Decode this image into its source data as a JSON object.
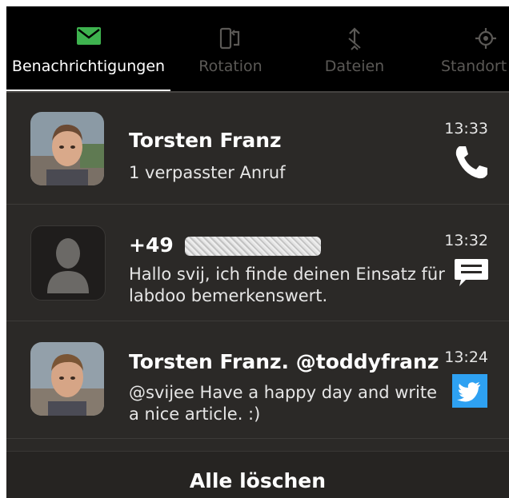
{
  "tabs": [
    {
      "label": "Benachrichtigungen",
      "icon": "envelope-icon",
      "active": true
    },
    {
      "label": "Rotation",
      "icon": "rotation-lock-icon",
      "active": false
    },
    {
      "label": "Dateien",
      "icon": "transfer-icon",
      "active": false
    },
    {
      "label": "Standort",
      "icon": "location-icon",
      "active": false
    }
  ],
  "notifications": [
    {
      "title": "Torsten Franz",
      "body": "1 verpasster Anruf",
      "time": "13:33",
      "type_icon": "phone-icon",
      "avatar": "contact-photo"
    },
    {
      "title": "+49",
      "body": "Hallo svij, ich finde deinen Einsatz für labdoo bemerkenswert.",
      "time": "13:32",
      "type_icon": "message-icon",
      "avatar": "contact-placeholder-avatar"
    },
    {
      "title": "Torsten Franz. @toddyfranz",
      "body": "@svijee Have a happy day and write a nice article. :)",
      "time": "13:24",
      "type_icon": "twitter-icon",
      "avatar": "contact-photo"
    }
  ],
  "clear_all_label": "Alle löschen",
  "colors": {
    "accent_green": "#3eb34f",
    "background": "#2b2927",
    "tabbar": "#000000",
    "twitter_blue": "#2ea1f2"
  }
}
